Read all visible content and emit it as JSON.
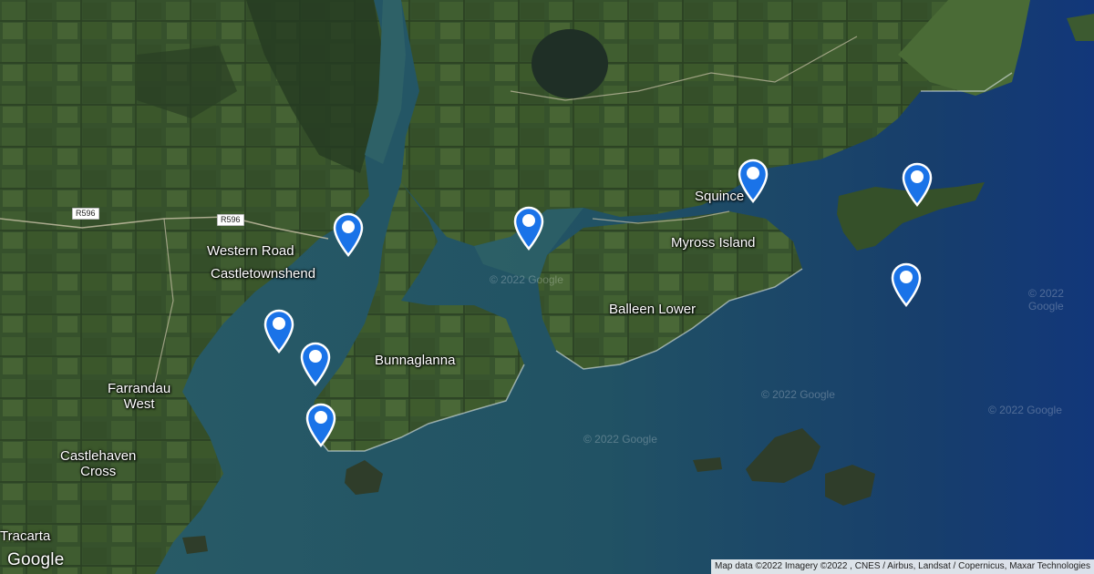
{
  "map": {
    "type": "satellite",
    "places": {
      "western_road": "Western Road",
      "castletownshend": "Castletownshend",
      "farrandau_line1": "Farrandau",
      "farrandau_line2": "West",
      "castlehaven_line1": "Castlehaven",
      "castlehaven_line2": "Cross",
      "tracarta": "Tracarta",
      "bunnaglanna": "Bunnaglanna",
      "balleen_lower": "Balleen Lower",
      "myross_island": "Myross Island",
      "squince": "Squince"
    },
    "roads": {
      "r596_a": "R596",
      "r596_b": "R596"
    },
    "markers": [
      {
        "name": "location-marker-1"
      },
      {
        "name": "location-marker-2"
      },
      {
        "name": "location-marker-3"
      },
      {
        "name": "location-marker-4"
      },
      {
        "name": "location-marker-5"
      },
      {
        "name": "location-marker-6"
      },
      {
        "name": "location-marker-7"
      },
      {
        "name": "location-marker-8"
      }
    ],
    "marker_color": "#1a73e8",
    "watermark": "© 2022 Google",
    "logo": "Google",
    "attribution": "Map data ©2022 Imagery ©2022 , CNES / Airbus, Landsat / Copernicus, Maxar Technologies"
  }
}
